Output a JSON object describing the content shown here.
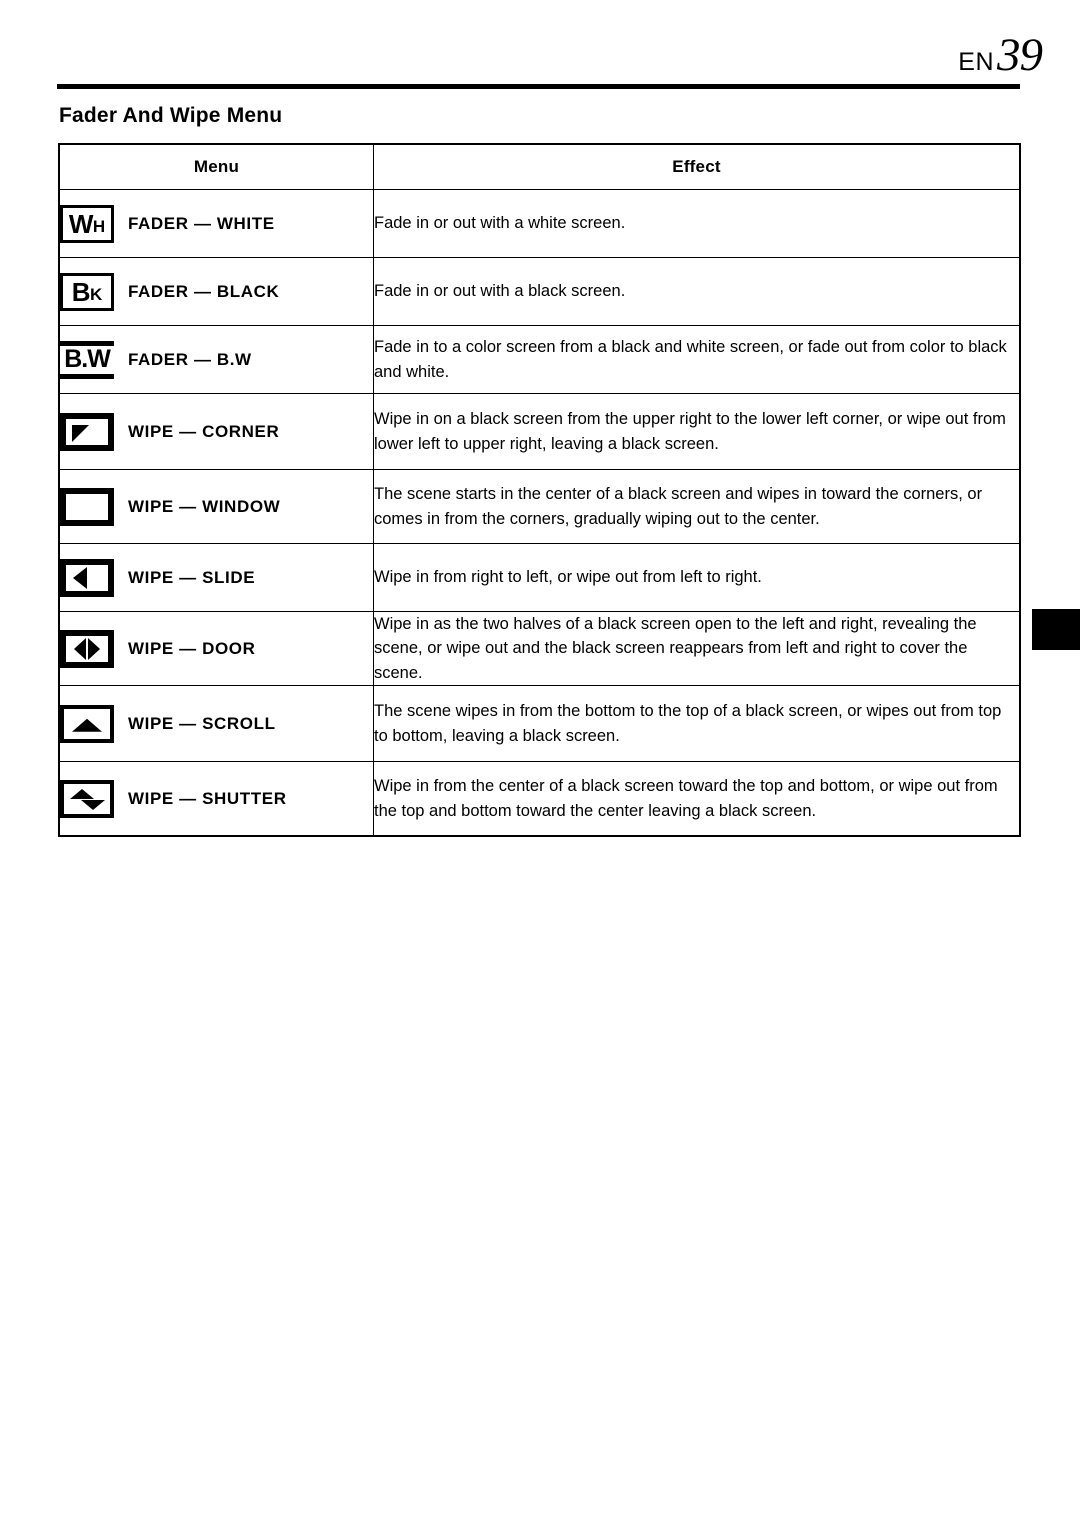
{
  "page": {
    "language_code": "EN",
    "page_number": "39",
    "section_title": "Fader And Wipe Menu"
  },
  "table": {
    "headers": {
      "menu": "Menu",
      "effect": "Effect"
    },
    "rows": [
      {
        "icon": "wh-boxed-icon",
        "icon_text_big": "W",
        "icon_text_small": "H",
        "label": "FADER — WHITE",
        "effect": "Fade in or out with a white screen."
      },
      {
        "icon": "bk-boxed-icon",
        "icon_text_big": "B",
        "icon_text_small": "K",
        "label": "FADER — BLACK",
        "effect": "Fade in or out with a black screen."
      },
      {
        "icon": "bw-barred-icon",
        "icon_text": "B.W",
        "label": "FADER — B.W",
        "effect": "Fade in to a color screen from a black and white screen, or fade out from color to black and white."
      },
      {
        "icon": "wipe-corner-icon",
        "label": "WIPE — CORNER",
        "effect": "Wipe in on a black screen from the upper right to the lower left corner, or wipe out from lower left to upper right, leaving a black screen."
      },
      {
        "icon": "wipe-window-icon",
        "label": "WIPE — WINDOW",
        "effect": "The scene starts in the center of a black screen and wipes in toward the corners, or comes in from the corners, gradually wiping out to the center."
      },
      {
        "icon": "wipe-slide-icon",
        "label": "WIPE — SLIDE",
        "effect": "Wipe in from right to left, or wipe out from left to right."
      },
      {
        "icon": "wipe-door-icon",
        "label": "WIPE — DOOR",
        "effect": "Wipe in as the two halves of a black screen open to the left and right, revealing the scene, or wipe out and the black screen reappears from left and right to cover the scene."
      },
      {
        "icon": "wipe-scroll-icon",
        "label": "WIPE — SCROLL",
        "effect": "The scene wipes in from the bottom to the top of a black screen, or wipes out from top to bottom, leaving a black screen."
      },
      {
        "icon": "wipe-shutter-icon",
        "label": "WIPE — SHUTTER",
        "effect": "Wipe in from the center of a black screen toward the top and bottom, or wipe out from the top and bottom toward the center leaving a black screen."
      }
    ]
  },
  "colors": {
    "ink": "#000000",
    "paper": "#ffffff"
  }
}
